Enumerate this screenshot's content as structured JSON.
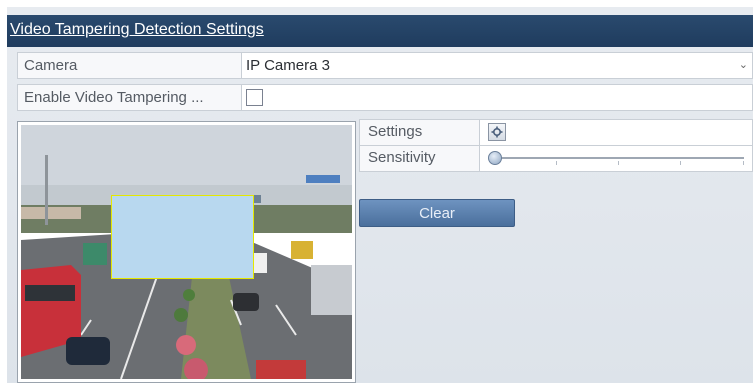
{
  "title": "Video Tampering Detection Settings",
  "camera": {
    "label": "Camera",
    "value": "IP Camera 3"
  },
  "enable": {
    "label": "Enable Video Tampering ...",
    "checked": false
  },
  "settings": {
    "label": "Settings"
  },
  "sensitivity": {
    "label": "Sensitivity",
    "level": 0
  },
  "clear_label": "Clear",
  "colors": {
    "title_bar": "#1f3c5e",
    "mask": "#b8d8ef",
    "mask_border": "#e4e800",
    "button": "#4a6f9c"
  },
  "icons": {
    "dropdown": "chevron-down-icon",
    "settings": "gear-icon"
  }
}
